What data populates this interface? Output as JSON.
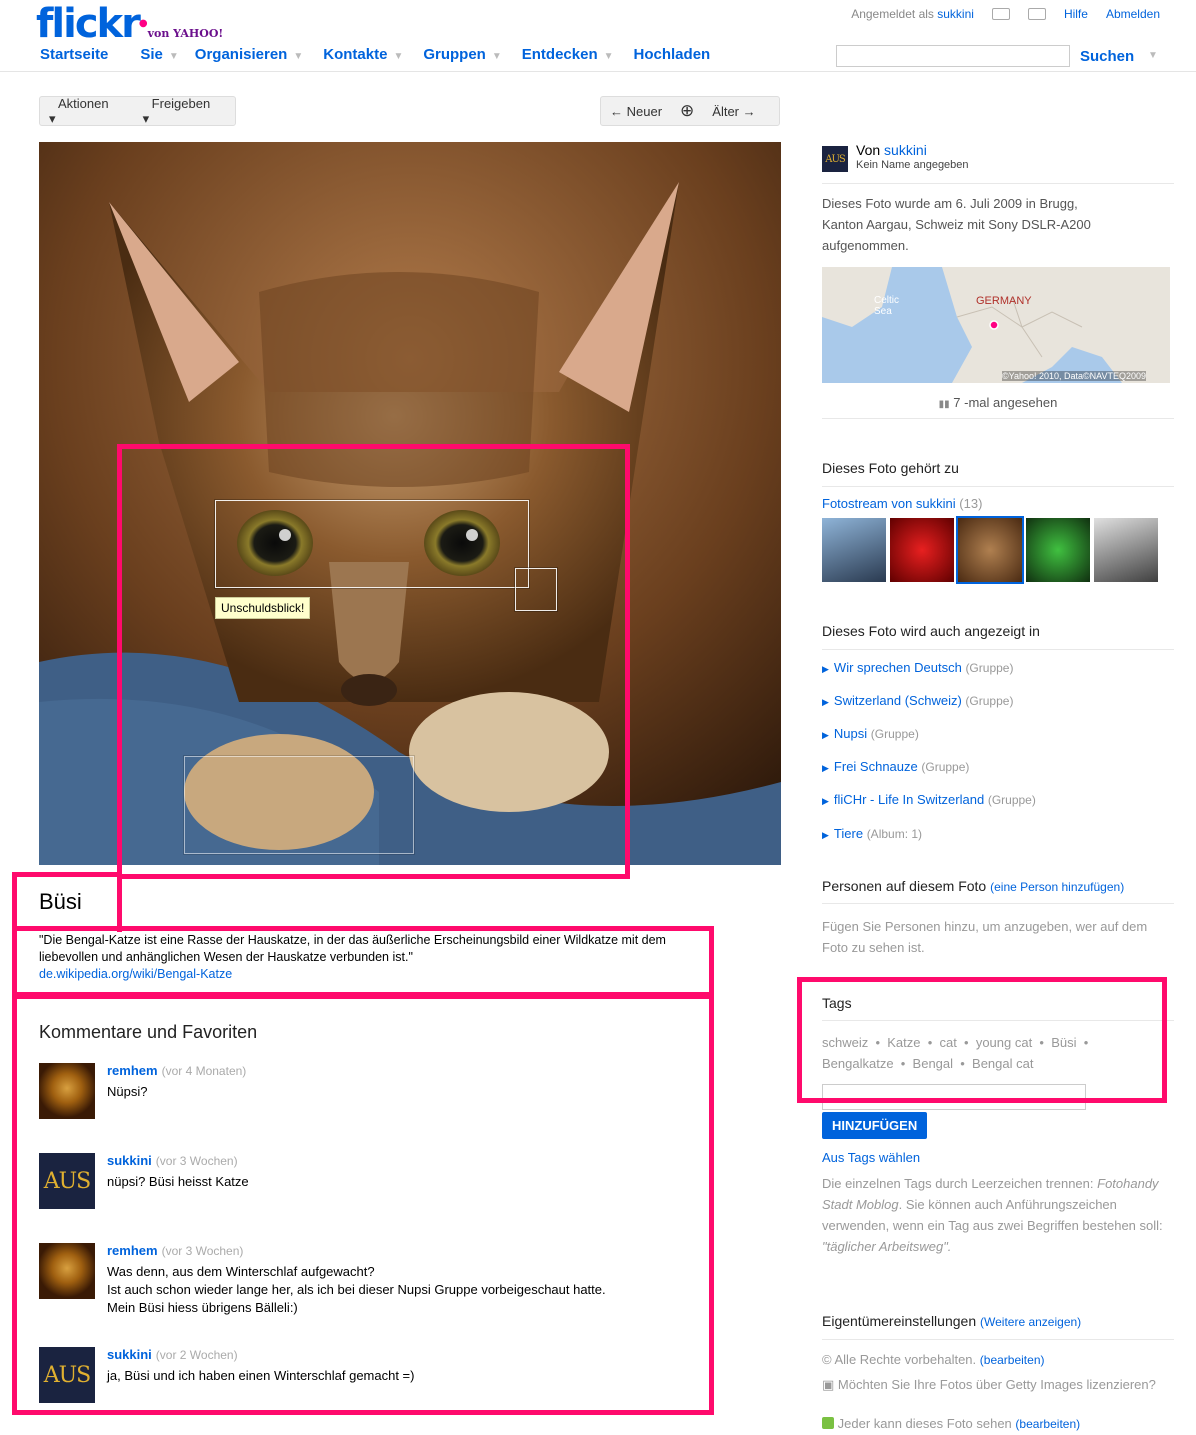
{
  "header": {
    "logo_text": "flickr",
    "logo_sub": "von YAHOO!",
    "signed_in_label": "Angemeldet als",
    "signed_in_user": "sukkini",
    "help": "Hilfe",
    "logout": "Abmelden",
    "nav": [
      "Startseite",
      "Sie",
      "Organisieren",
      "Kontakte",
      "Gruppen",
      "Entdecken",
      "Hochladen"
    ],
    "search_button": "Suchen",
    "search_placeholder": ""
  },
  "toolbar": {
    "actions": "Aktionen",
    "share": "Freigeben",
    "newer": "← Neuer",
    "zoom": "⊕",
    "older": "Älter →"
  },
  "photo": {
    "note_label": "Unschuldsblick!"
  },
  "main": {
    "title": "Büsi",
    "description": "\"Die Bengal-Katze ist eine Rasse der Hauskatze, in der das äußerliche Erscheinungsbild einer Wildkatze mit dem liebevollen und anhänglichen Wesen der Hauskatze verbunden ist.\"",
    "description_link": "de.wikipedia.org/wiki/Bengal-Katze",
    "comments_heading": "Kommentare und Favoriten",
    "comments": [
      {
        "user": "remhem",
        "when": "(vor 4 Monaten)",
        "text": [
          "Nüpsi?"
        ],
        "avatar": "remhem-avatar"
      },
      {
        "user": "sukkini",
        "when": "(vor 3 Wochen)",
        "text": [
          "nüpsi? Büsi heisst Katze"
        ],
        "avatar": "aus-avatar"
      },
      {
        "user": "remhem",
        "when": "(vor 3 Wochen)",
        "text": [
          "Was denn, aus dem Winterschlaf aufgewacht?",
          "Ist auch schon wieder lange her, als ich bei dieser Nupsi Gruppe vorbeigeschaut hatte.",
          "Mein Büsi hiess übrigens Bälleli:)"
        ],
        "avatar": "remhem-avatar"
      },
      {
        "user": "sukkini",
        "when": "(vor 2 Wochen)",
        "text": [
          "ja, Büsi und ich haben einen Winterschlaf gemacht =)"
        ],
        "avatar": "aus-avatar"
      }
    ]
  },
  "sidebar": {
    "by_label": "Von",
    "owner": "sukkini",
    "owner_sub": "Kein Name angegeben",
    "photo_info": "Dieses Foto wurde am 6. Juli 2009 in Brugg, Kanton Aargau, Schweiz mit Sony DSLR-A200 aufgenommen.",
    "map_labels": {
      "sea": "Celtic Sea",
      "country": "GERMANY",
      "credit": "©Yahoo! 2010, Data©NAVTEQ2009"
    },
    "views": "7 -mal angesehen",
    "belongs_heading": "Dieses Foto gehört zu",
    "photostream_link": "Fotostream von sukkini",
    "photostream_count": "(13)",
    "also_in_heading": "Dieses Foto wird auch angezeigt in",
    "groups": [
      {
        "name": "Wir sprechen Deutsch",
        "kind": "(Gruppe)"
      },
      {
        "name": "Switzerland (Schweiz)",
        "kind": "(Gruppe)"
      },
      {
        "name": "Nupsi",
        "kind": "(Gruppe)"
      },
      {
        "name": "Frei Schnauze",
        "kind": "(Gruppe)"
      },
      {
        "name": "fliCHr - Life In Switzerland",
        "kind": "(Gruppe)"
      },
      {
        "name": "Tiere",
        "kind": "(Album: 1)"
      }
    ],
    "people_heading": "Personen auf diesem Foto",
    "people_add": "(eine Person hinzufügen)",
    "people_hint": "Fügen Sie Personen hinzu, um anzugeben, wer auf dem Foto zu sehen ist.",
    "tags_heading": "Tags",
    "tags": [
      "schweiz",
      "Katze",
      "cat",
      "young cat",
      "Büsi",
      "Bengalkatze",
      "Bengal",
      "Bengal cat"
    ],
    "tags_line1": "schweiz  •  Katze  •  cat  •  young cat  •  Büsi  •",
    "tags_line2": "Bengalkatze  •  Bengal  •  Bengal cat",
    "add_button": "HINZUFÜGEN",
    "choose_tags": "Aus Tags wählen",
    "tag_help_1": "Die einzelnen Tags durch Leerzeichen trennen:",
    "tag_help_2": "Fotohandy Stadt Moblog",
    "tag_help_3": ". Sie können auch Anführungszeichen verwenden, wenn ein Tag aus zwei Begriffen bestehen soll:",
    "tag_help_4": "\"täglicher Arbeitsweg\".",
    "owner_settings_heading": "Eigentümereinstellungen",
    "owner_settings_more": "(Weitere anzeigen)",
    "rights": "Alle Rechte vorbehalten.",
    "edit": "(bearbeiten)",
    "getty": "Möchten Sie Ihre Fotos über Getty Images lizenzieren?",
    "visibility": "Jeder kann dieses Foto sehen"
  },
  "colors": {
    "link": "#0063dc",
    "highlight": "#ff0a6c",
    "flickr_pink": "#ff0084"
  }
}
